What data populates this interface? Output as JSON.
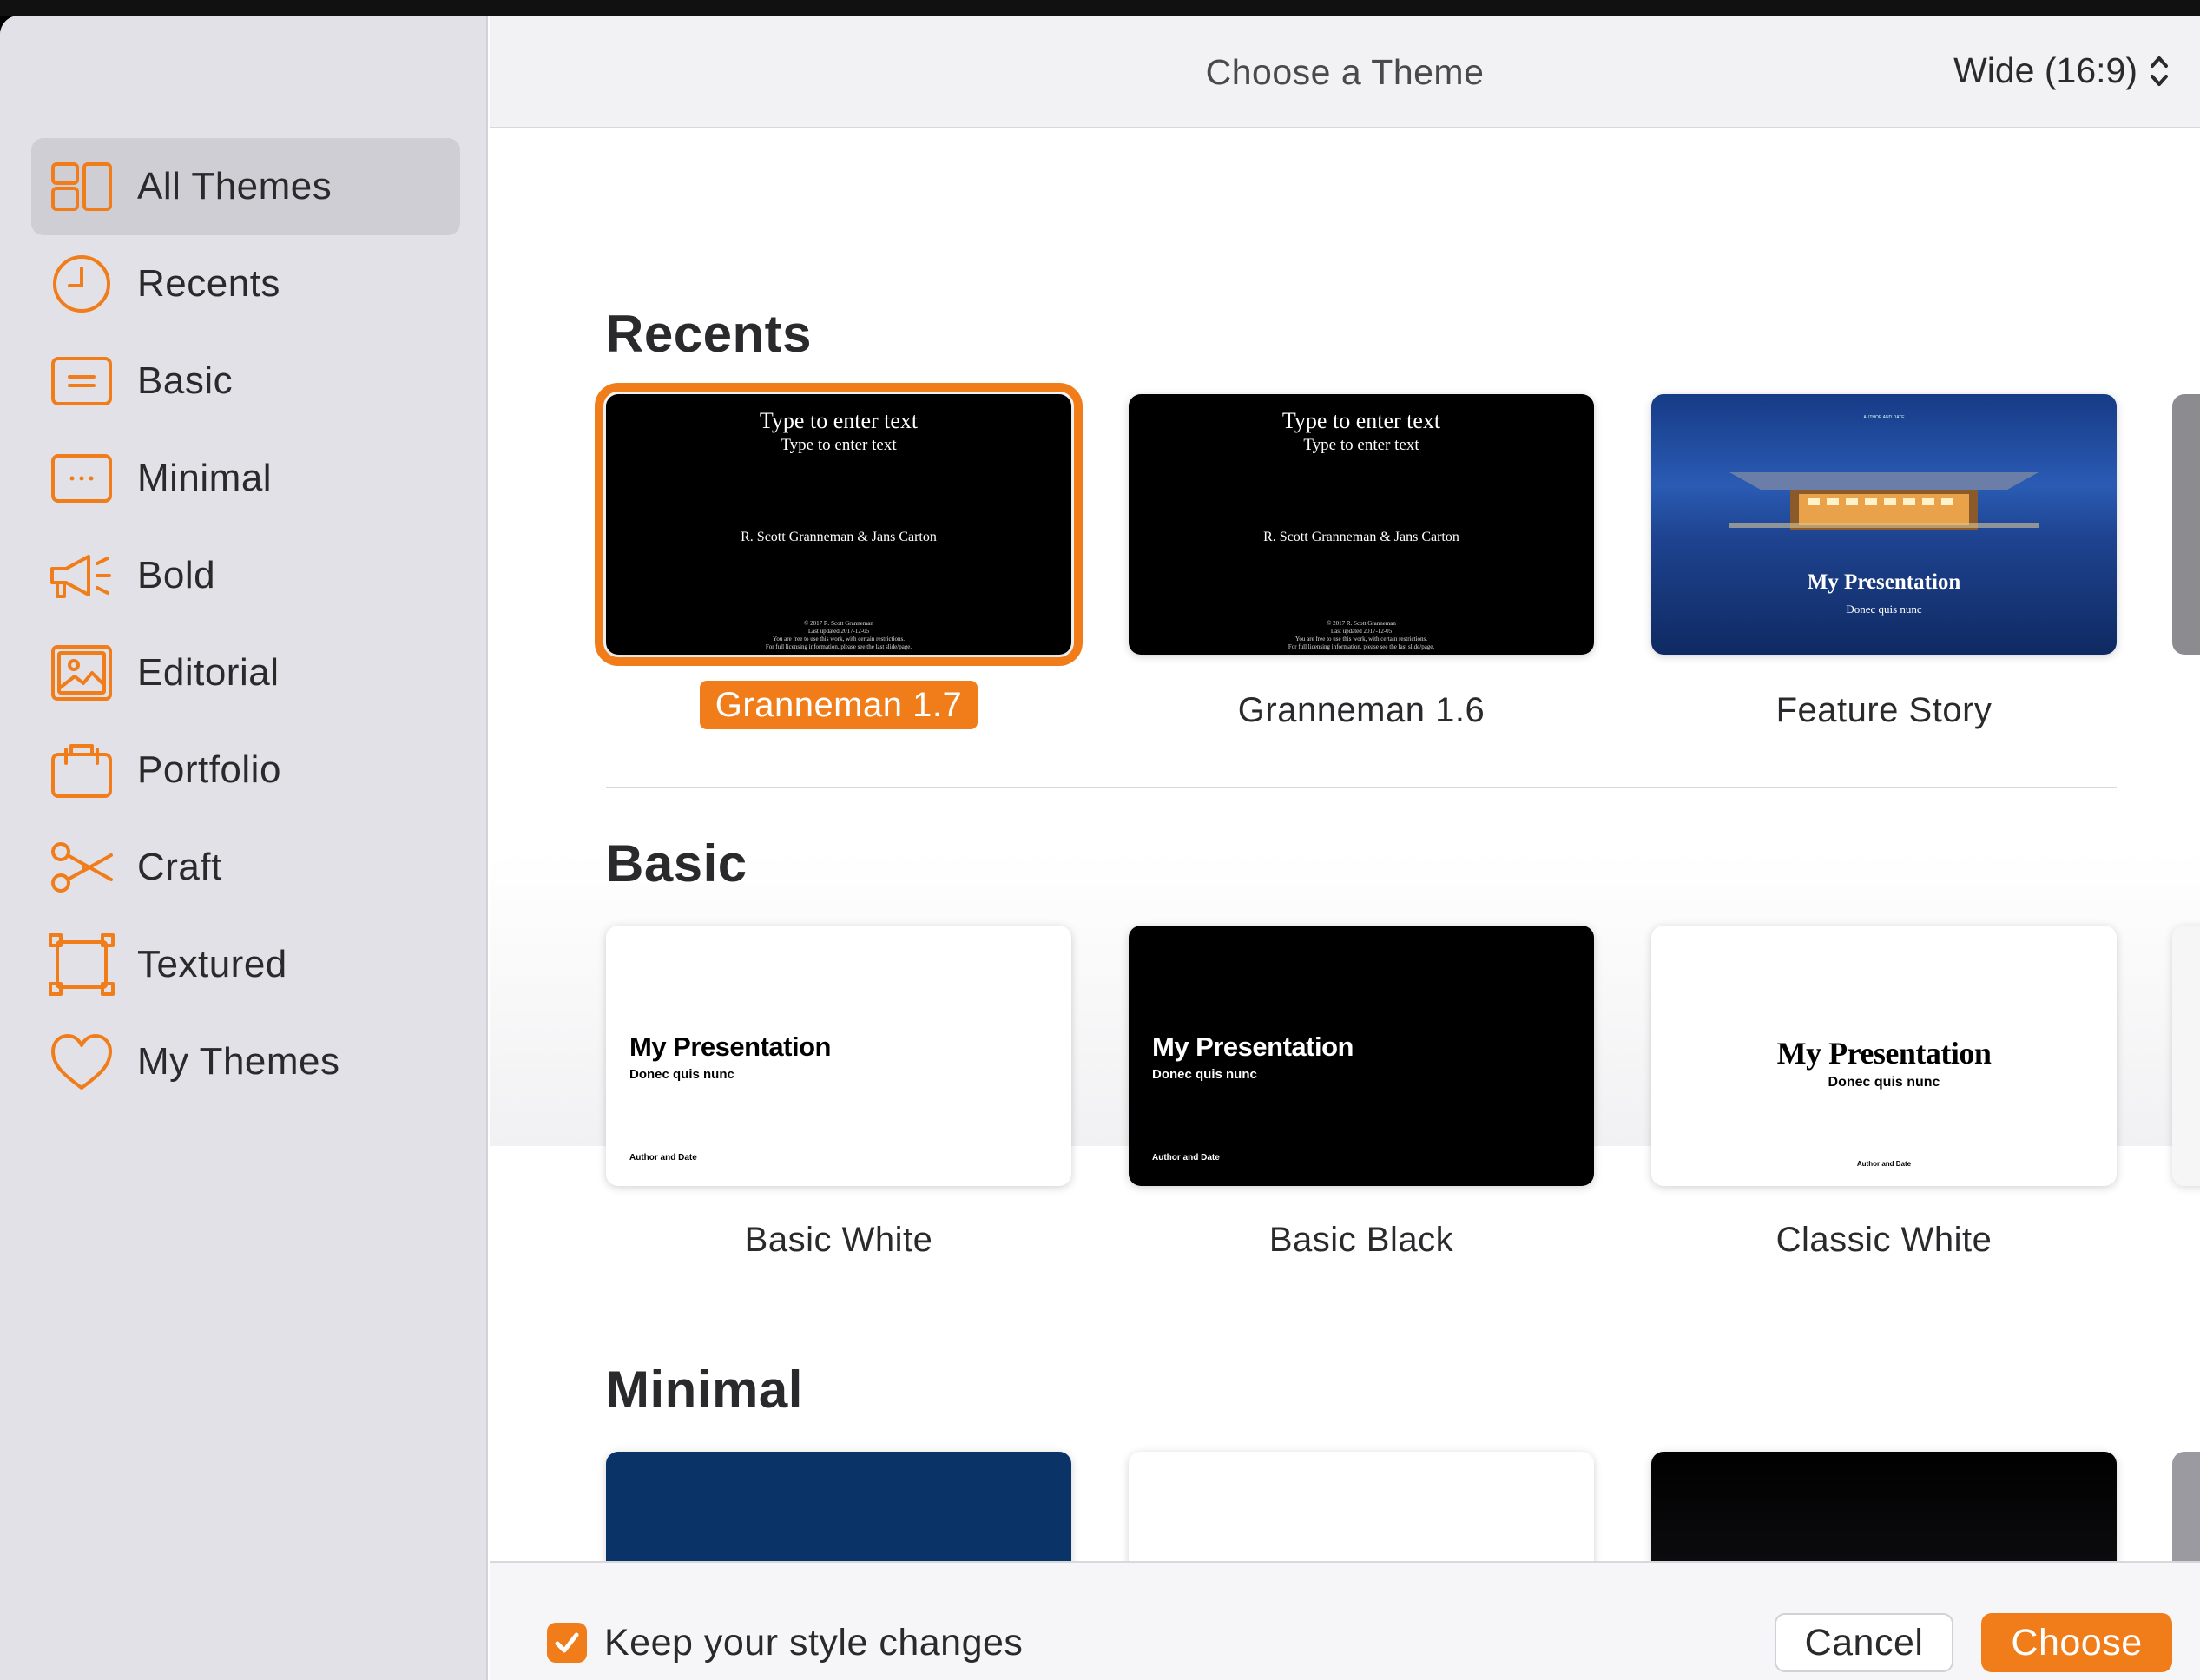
{
  "header": {
    "title": "Choose a Theme",
    "size_select": "Wide (16:9)"
  },
  "sidebar": {
    "items": [
      {
        "label": "All Themes",
        "icon": "all-themes-icon",
        "active": true
      },
      {
        "label": "Recents",
        "icon": "clock-icon"
      },
      {
        "label": "Basic",
        "icon": "basic-slide-icon"
      },
      {
        "label": "Minimal",
        "icon": "minimal-slide-icon"
      },
      {
        "label": "Bold",
        "icon": "megaphone-icon"
      },
      {
        "label": "Editorial",
        "icon": "photo-icon"
      },
      {
        "label": "Portfolio",
        "icon": "portfolio-icon"
      },
      {
        "label": "Craft",
        "icon": "scissors-icon"
      },
      {
        "label": "Textured",
        "icon": "textured-frame-icon"
      },
      {
        "label": "My Themes",
        "icon": "heart-icon"
      }
    ],
    "accent": "#f07d1a"
  },
  "sections": {
    "recents": {
      "title": "Recents",
      "themes": [
        {
          "name": "Granneman 1.7",
          "selected": true,
          "slide": {
            "title": "Type to enter text",
            "subtitle": "Type to enter text",
            "author": "R. Scott Granneman & Jans Carton",
            "footer": [
              "© 2017 R. Scott Granneman",
              "Last updated 2017-12-05",
              "You are free to use this work, with certain restrictions.",
              "For full licensing information, please see the last slide/page."
            ]
          }
        },
        {
          "name": "Granneman 1.6",
          "slide": {
            "title": "Type to enter text",
            "subtitle": "Type to enter text",
            "author": "R. Scott Granneman & Jans Carton",
            "footer": [
              "© 2017 R. Scott Granneman",
              "Last updated 2017-12-05",
              "You are free to use this work, with certain restrictions.",
              "For full licensing information, please see the last slide/page."
            ]
          }
        },
        {
          "name": "Feature Story",
          "slide": {
            "header": "AUTHOR AND DATE",
            "title": "My Presentation",
            "subtitle": "Donec quis nunc"
          }
        }
      ]
    },
    "basic": {
      "title": "Basic",
      "themes": [
        {
          "name": "Basic White",
          "slide": {
            "title": "My Presentation",
            "subtitle": "Donec quis nunc",
            "author": "Author and Date"
          }
        },
        {
          "name": "Basic Black",
          "slide": {
            "title": "My Presentation",
            "subtitle": "Donec quis nunc",
            "author": "Author and Date"
          }
        },
        {
          "name": "Classic White",
          "slide": {
            "title": "My Presentation",
            "subtitle": "Donec quis nunc",
            "author": "Author and Date"
          }
        }
      ]
    },
    "minimal": {
      "title": "Minimal"
    }
  },
  "footer": {
    "keep_style_label": "Keep your style changes",
    "keep_style_checked": true,
    "cancel_label": "Cancel",
    "choose_label": "Choose"
  }
}
